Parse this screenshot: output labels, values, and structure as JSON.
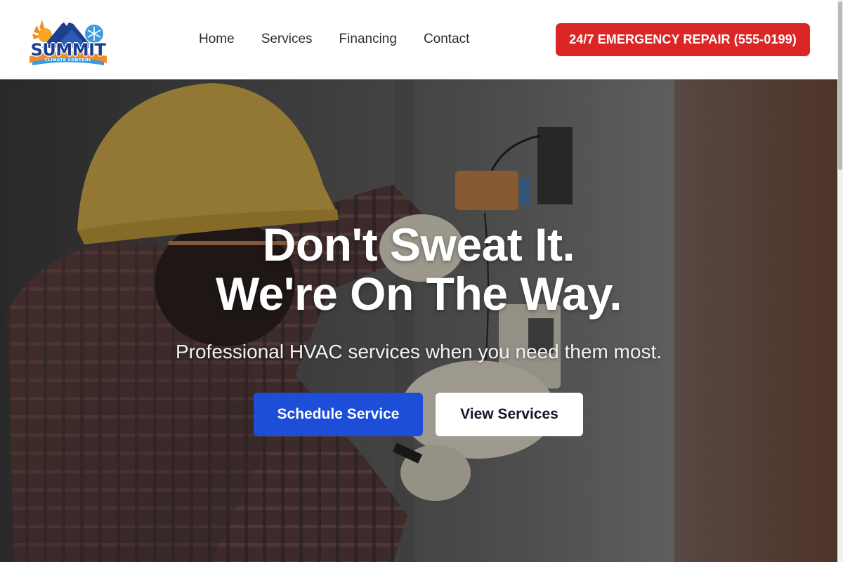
{
  "brand": {
    "name": "SUMMIT",
    "tagline": "CLIMATE CONTROL",
    "colors": {
      "navy": "#1d3f8f",
      "orange": "#f28c28",
      "sky": "#3b9be0"
    }
  },
  "nav": {
    "items": [
      {
        "label": "Home"
      },
      {
        "label": "Services"
      },
      {
        "label": "Financing"
      },
      {
        "label": "Contact"
      }
    ]
  },
  "header": {
    "emergency_label": "24/7 EMERGENCY REPAIR (555-0199)",
    "emergency_color": "#dc2626"
  },
  "hero": {
    "title_line1": "Don't Sweat It.",
    "title_line2": "We're On The Way.",
    "subtitle": "Professional HVAC services when you need them most.",
    "primary_cta": "Schedule Service",
    "secondary_cta": "View Services",
    "primary_color": "#1d4ed8",
    "background_image": "technician-hardhat-thermostat-photo"
  }
}
